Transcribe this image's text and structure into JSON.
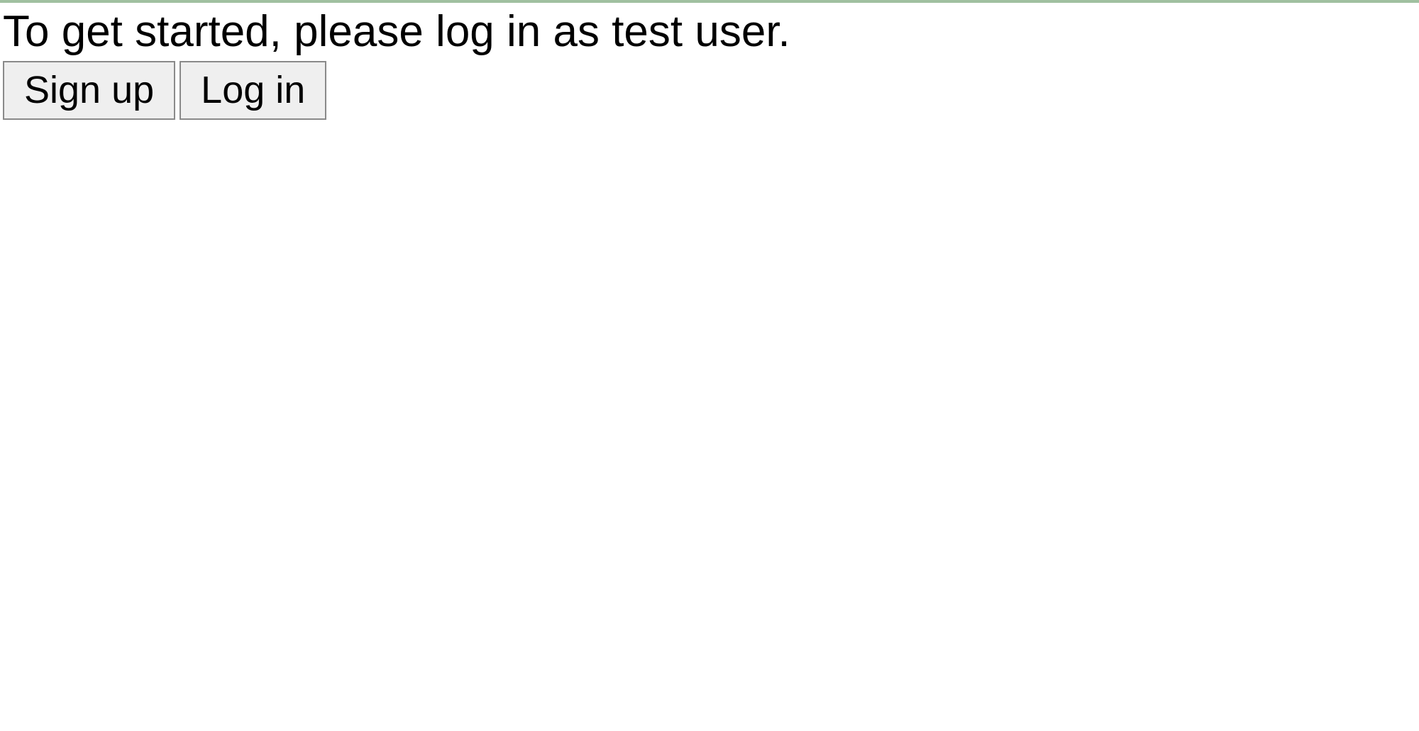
{
  "instruction": "To get started, please log in as test user.",
  "buttons": {
    "signup": "Sign up",
    "login": "Log in"
  }
}
